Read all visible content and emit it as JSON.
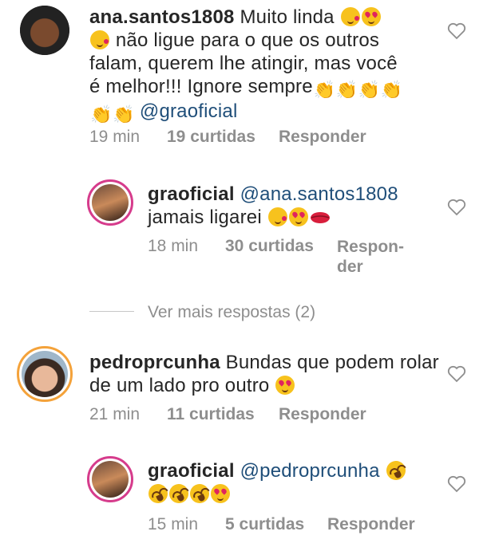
{
  "comments": [
    {
      "username": "ana.santos1808",
      "text_parts": [
        "Muito linda",
        "não ligue para o que os outros",
        "falam, querem lhe atingir, mas você",
        "é melhor!!! Ignore sempre",
        "@graoficial"
      ],
      "time": "19 min",
      "likes": "19 curtidas",
      "reply": "Responder"
    },
    {
      "username": "graoficial",
      "mention": "@ana.santos1808",
      "text": "jamais ligarei",
      "time": "18 min",
      "likes": "30 curtidas",
      "reply_line1": "Respon-",
      "reply_line2": "der"
    },
    {
      "username": "pedroprcunha",
      "text_line1": "Bundas que podem rolar",
      "text_line2": "de um lado pro outro",
      "time": "21 min",
      "likes": "11 curtidas",
      "reply": "Responder"
    },
    {
      "username": "graoficial",
      "mention": "@pedroprcunha",
      "time": "15 min",
      "likes": "5 curtidas",
      "reply": "Responder"
    }
  ],
  "view_more": "Ver mais respostas (2)",
  "icons": {
    "like": "heart-outline-icon"
  },
  "colors": {
    "mention": "#1f4e79",
    "meta": "#8e8e8e",
    "story_ring": "#f4a23a"
  }
}
